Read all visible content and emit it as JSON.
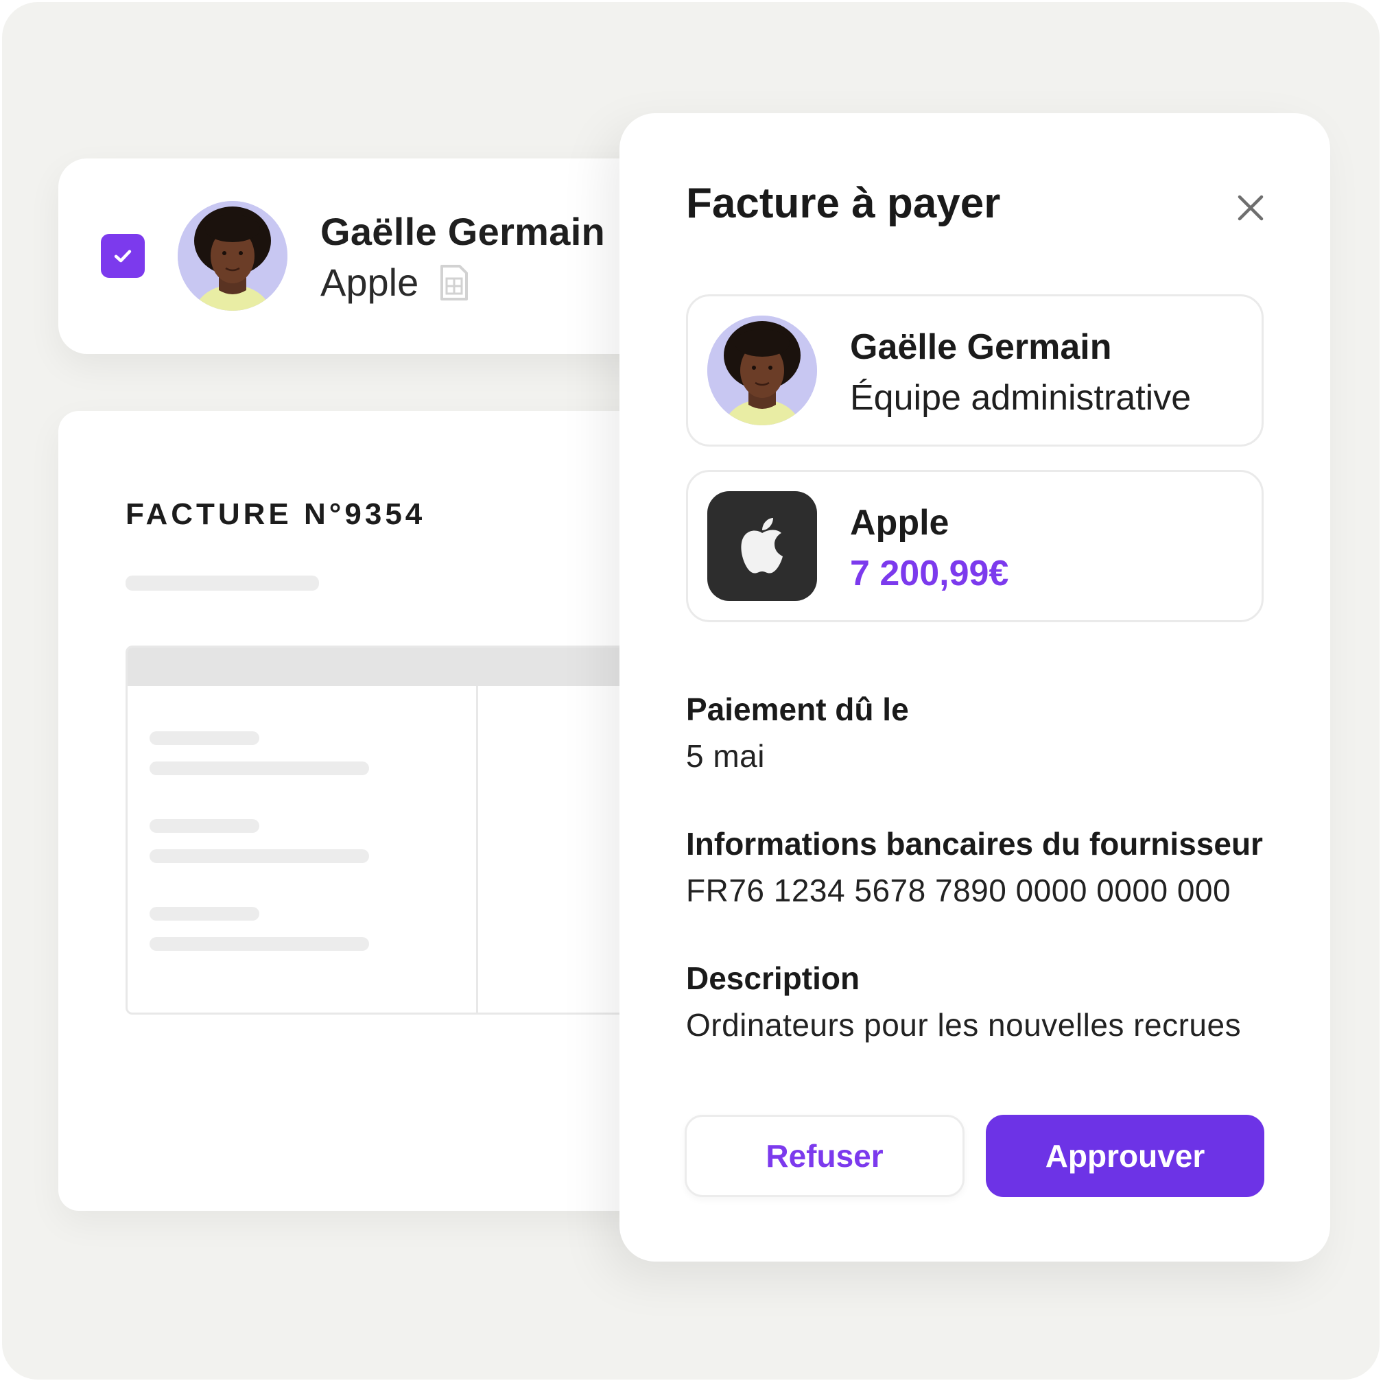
{
  "row": {
    "name": "Gaëlle Germain",
    "company": "Apple",
    "checked": true
  },
  "invoice_doc": {
    "title": "FACTURE N°9354"
  },
  "panel": {
    "title": "Facture à payer",
    "requester": {
      "name": "Gaëlle Germain",
      "team": "Équipe administrative"
    },
    "supplier": {
      "name": "Apple",
      "amount": "7 200,99€"
    },
    "due": {
      "label": "Paiement dû le",
      "value": "5 mai"
    },
    "bank": {
      "label": "Informations bancaires du fournisseur",
      "value": "FR76 1234 5678 7890 0000 0000 000"
    },
    "description": {
      "label": "Description",
      "value": "Ordinateurs pour les nouvelles recrues"
    },
    "buttons": {
      "refuse": "Refuser",
      "approve": "Approuver"
    }
  },
  "colors": {
    "accent": "#7c3aed",
    "background": "#f2f2ef"
  }
}
